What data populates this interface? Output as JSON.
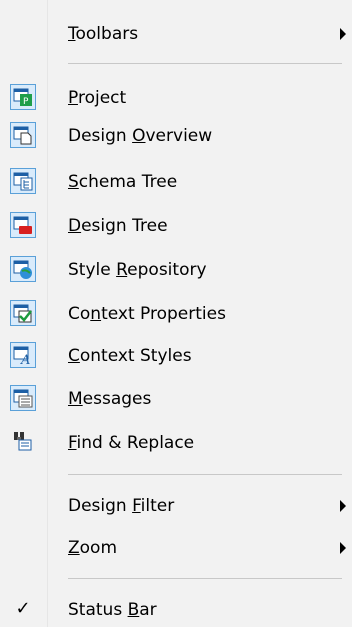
{
  "menu": {
    "items": [
      {
        "id": "toolbars",
        "label_before": "",
        "mnemonic": "T",
        "label_after": "oolbars",
        "submenu": true
      },
      {
        "id": "project",
        "label_before": "",
        "mnemonic": "P",
        "label_after": "roject",
        "icon": "project-icon"
      },
      {
        "id": "design-overview",
        "label_before": "Design ",
        "mnemonic": "O",
        "label_after": "verview",
        "icon": "design-overview-icon"
      },
      {
        "id": "schema-tree",
        "label_before": "",
        "mnemonic": "S",
        "label_after": "chema Tree",
        "icon": "schema-tree-icon"
      },
      {
        "id": "design-tree",
        "label_before": "",
        "mnemonic": "D",
        "label_after": "esign Tree",
        "icon": "design-tree-icon"
      },
      {
        "id": "style-repository",
        "label_before": "Style ",
        "mnemonic": "R",
        "label_after": "epository",
        "icon": "style-repository-icon"
      },
      {
        "id": "context-properties",
        "label_before": "Co",
        "mnemonic": "n",
        "label_after": "text Properties",
        "icon": "context-properties-icon"
      },
      {
        "id": "context-styles",
        "label_before": "",
        "mnemonic": "C",
        "label_after": "ontext Styles",
        "icon": "context-styles-icon"
      },
      {
        "id": "messages",
        "label_before": "",
        "mnemonic": "M",
        "label_after": "essages",
        "icon": "messages-icon"
      },
      {
        "id": "find-replace",
        "label_before": "",
        "mnemonic": "F",
        "label_after": "ind & Replace",
        "icon": "find-replace-icon"
      },
      {
        "id": "design-filter",
        "label_before": "Design ",
        "mnemonic": "F",
        "label_after": "ilter",
        "submenu": true
      },
      {
        "id": "zoom",
        "label_before": "",
        "mnemonic": "Z",
        "label_after": "oom",
        "submenu": true
      },
      {
        "id": "status-bar",
        "label_before": "Status ",
        "mnemonic": "B",
        "label_after": "ar",
        "checked": true
      }
    ],
    "check_glyph": "✓"
  }
}
